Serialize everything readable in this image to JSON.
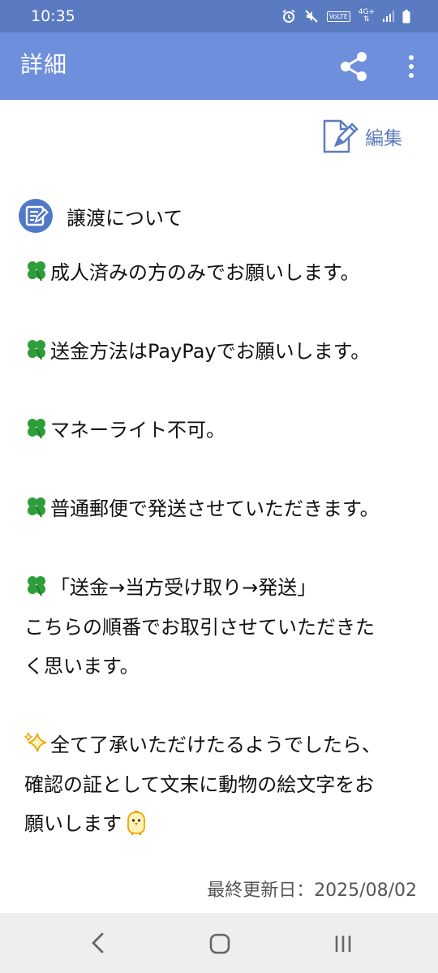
{
  "status_bar": {
    "time": "10:35",
    "icons": [
      "alarm-icon",
      "mute-icon",
      "volte-icon",
      "4g-icon",
      "signal-icon",
      "battery-icon"
    ],
    "network": "4G+",
    "volte": "VoLTE"
  },
  "app_bar": {
    "title": "詳細",
    "actions": [
      "share-icon",
      "more-icon"
    ]
  },
  "edit": {
    "label": "編集",
    "icon": "edit-document-icon"
  },
  "section": {
    "title": "譲渡について",
    "icon": "memo-icon"
  },
  "lines": [
    {
      "icon": "clover",
      "text": "成人済みの方のみでお願いします。"
    },
    {
      "icon": "clover",
      "text": "送金方法はPayPayでお願いします。"
    },
    {
      "icon": "clover",
      "text": "マネーライト不可。"
    },
    {
      "icon": "clover",
      "text": "普通郵便で発送させていただきます。"
    },
    {
      "icon": "clover",
      "text": "「送金→当方受け取り→発送」"
    },
    {
      "icon": "",
      "text": "こちらの順番でお取引させていただきた"
    },
    {
      "icon": "",
      "text": "く思います。"
    },
    {
      "icon": "sparkles",
      "text": "全て了承いただけたるようでしたら、"
    },
    {
      "icon": "",
      "text": "確認の証として文末に動物の絵文字をお"
    },
    {
      "icon": "",
      "text": "願いします"
    }
  ],
  "emoji": {
    "end_of_last_line": "chick"
  },
  "updated": {
    "text": "最終更新日：2025/08/02"
  },
  "nav": [
    "back",
    "home",
    "recent-apps"
  ],
  "colors": {
    "status_bar": "#5a7bc2",
    "app_bar": "#6e8fdc",
    "accent": "#5f7cbf",
    "clover": "#2e9e3a",
    "nav_bar": "#eeeeee"
  }
}
